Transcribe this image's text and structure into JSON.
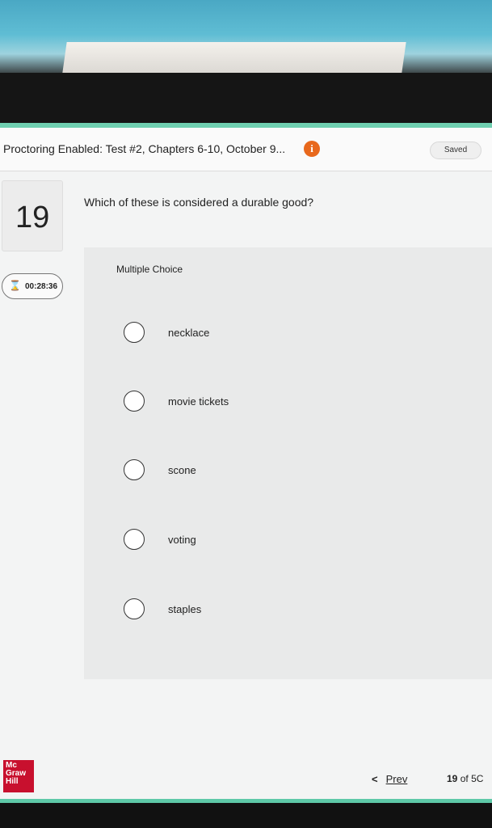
{
  "header": {
    "title": "Proctoring Enabled: Test #2, Chapters 6-10, October 9...",
    "info_icon_glyph": "i",
    "saved_label": "Saved"
  },
  "question": {
    "number": "19",
    "text": "Which of these is considered a durable good?",
    "type_label": "Multiple Choice"
  },
  "timer": {
    "icon": "hourglass-icon",
    "value": "00:28:36"
  },
  "options": [
    {
      "label": "necklace"
    },
    {
      "label": "movie tickets"
    },
    {
      "label": "scone"
    },
    {
      "label": "voting"
    },
    {
      "label": "staples"
    }
  ],
  "footer": {
    "logo_line1": "Mc",
    "logo_line2": "Graw",
    "logo_line3": "Hill",
    "prev_label": "Prev",
    "current_page": "19",
    "of_label": "of",
    "total_pages_visible": "5C"
  },
  "colors": {
    "accent_green": "#6fcfb0",
    "info_orange": "#e8681c",
    "logo_red": "#c8102e"
  }
}
